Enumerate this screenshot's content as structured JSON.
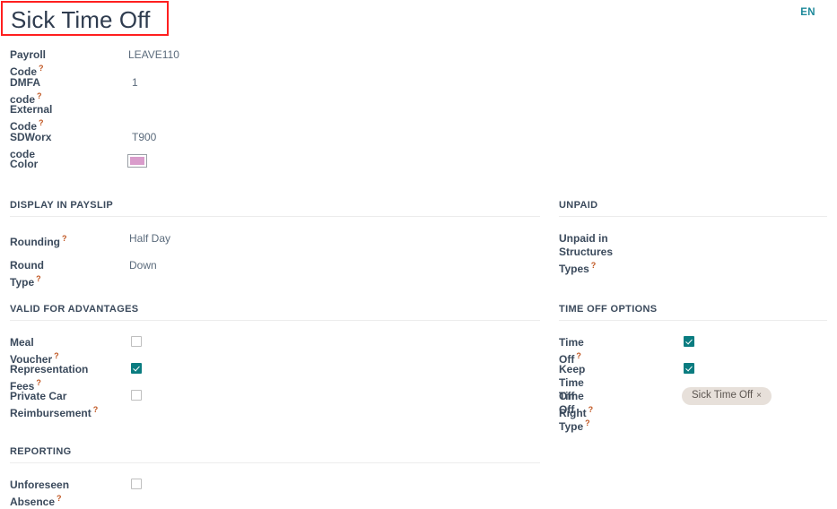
{
  "header": {
    "title": "Sick Time Off",
    "language_badge": "EN",
    "highlight_color": "#ff1f1f"
  },
  "top_fields": [
    {
      "label": "Payroll Code",
      "help": "?",
      "value": "LEAVE110"
    },
    {
      "label": "DMFA code",
      "help": "?",
      "value": "1"
    },
    {
      "label": "External Code",
      "help": "?",
      "value": ""
    },
    {
      "label": "SDWorx code",
      "help": "",
      "value": "T900"
    },
    {
      "label": "Color",
      "help": "",
      "value": "",
      "swatch_color": "#d99ccb"
    }
  ],
  "sections": {
    "display_in_payslip": {
      "title": "DISPLAY IN PAYSLIP",
      "fields": [
        {
          "label": "Rounding",
          "help": "?",
          "value": "Half Day"
        },
        {
          "label": "Round Type",
          "help": "?",
          "value": "Down"
        }
      ]
    },
    "unpaid": {
      "title": "UNPAID",
      "fields": [
        {
          "label": "Unpaid in Structures\nTypes",
          "help": "?",
          "value": ""
        }
      ]
    },
    "valid_for_advantages": {
      "title": "VALID FOR ADVANTAGES",
      "fields": [
        {
          "label": "Meal Voucher",
          "help": "?",
          "checked": false
        },
        {
          "label": "Representation Fees",
          "help": "?",
          "checked": true
        },
        {
          "label": "Private Car\nReimbursement",
          "help": "?",
          "checked": false
        }
      ]
    },
    "time_off_options": {
      "title": "TIME OFF OPTIONS",
      "fields": [
        {
          "label": "Time Off",
          "help": "?",
          "checked": true
        },
        {
          "label": "Keep Time Off Right",
          "help": "?",
          "checked": true
        },
        {
          "label": "Time Off Type",
          "help": "?",
          "tag": "Sick Time Off",
          "tag_remove": "×"
        }
      ]
    },
    "reporting": {
      "title": "REPORTING",
      "fields": [
        {
          "label": "Unforeseen Absence",
          "help": "?",
          "checked": false
        }
      ]
    }
  },
  "theme": {
    "accent_teal": "#0a7c80",
    "label_color": "#3b4a5c",
    "value_color": "#5b6b7c",
    "help_color": "#c05621",
    "tag_bg": "#e7e0da"
  }
}
